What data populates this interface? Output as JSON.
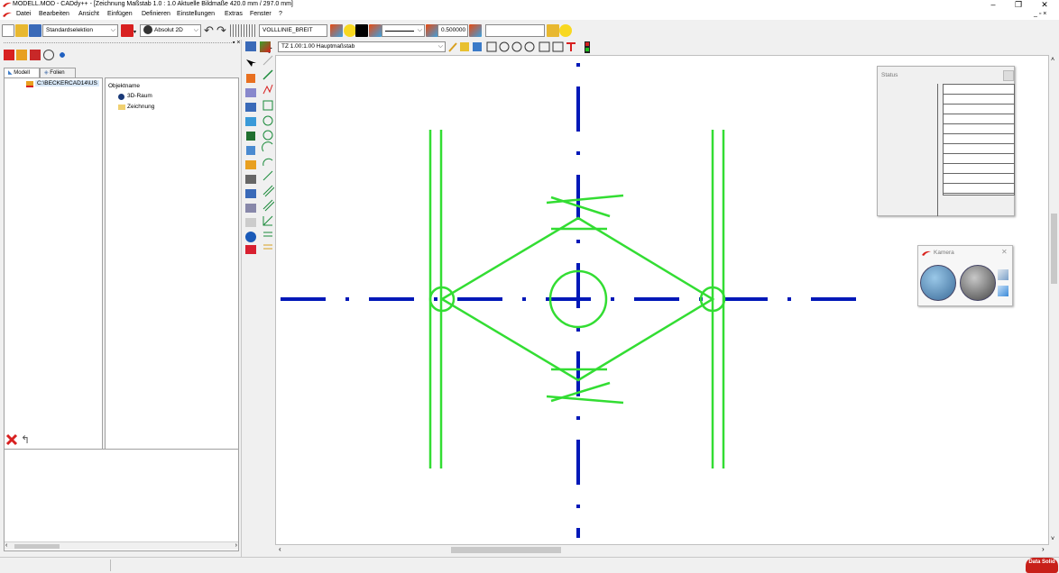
{
  "window": {
    "title": "MODELL.MOD  - CADdy++ - [Zeichnung   Maßstab 1.0 : 1.0   Aktuelle Bildmaße 420.0 mm / 297.0 mm]",
    "minimize": "–",
    "restore": "❐",
    "close": "✕"
  },
  "menu": {
    "items": [
      "Datei",
      "Bearbeiten",
      "Ansicht",
      "Einfügen",
      "Definieren",
      "Einstellungen",
      "Extras",
      "Fenster",
      "?"
    ],
    "mdi_controls": "_ ▫ ×"
  },
  "toolbar": {
    "selection_mode": "Standardselektion",
    "coord_mode": "Absolut 2D",
    "line_type": "VOLLLINIE_BREIT",
    "line_width": "0.500000",
    "free_input": ""
  },
  "canvas_toolbar": {
    "scale": "TZ 1.00:1.00 Hauptmaßstab"
  },
  "left_panel": {
    "tabs": [
      "Modell",
      "Folien"
    ],
    "tree_root": "C:\\BECKERCAD14\\US",
    "objects_header": "Objektname",
    "objects": [
      "3D-Raum",
      "Zeichnung"
    ]
  },
  "status_panel": {
    "title": "Status",
    "rows": 11
  },
  "kamera": {
    "title": "Kamera"
  },
  "colors": {
    "centerline": "#0018b8",
    "geometry": "#33dd33",
    "accent_red": "#d8201a"
  },
  "brand": "Data Solid"
}
